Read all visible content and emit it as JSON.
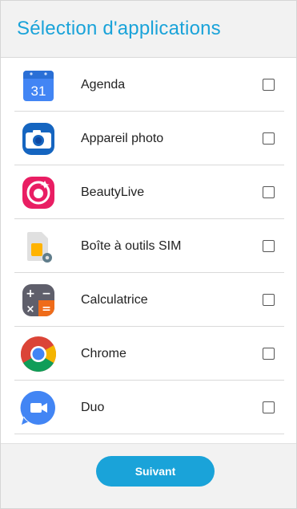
{
  "header": {
    "title": "Sélection d'applications"
  },
  "apps": [
    {
      "label": "Agenda",
      "icon": "calendar-icon",
      "calendar_day": "31",
      "checked": false
    },
    {
      "label": "Appareil photo",
      "icon": "camera-icon",
      "checked": false
    },
    {
      "label": "BeautyLive",
      "icon": "beautylive-icon",
      "checked": false
    },
    {
      "label": "Boîte à outils SIM",
      "icon": "sim-toolkit-icon",
      "checked": false
    },
    {
      "label": "Calculatrice",
      "icon": "calculator-icon",
      "checked": false
    },
    {
      "label": "Chrome",
      "icon": "chrome-icon",
      "checked": false
    },
    {
      "label": "Duo",
      "icon": "duo-icon",
      "checked": false
    }
  ],
  "footer": {
    "next_label": "Suivant"
  },
  "colors": {
    "accent": "#1aa3d9",
    "header_bg": "#f2f2f2",
    "divider": "#d9d9d9"
  }
}
